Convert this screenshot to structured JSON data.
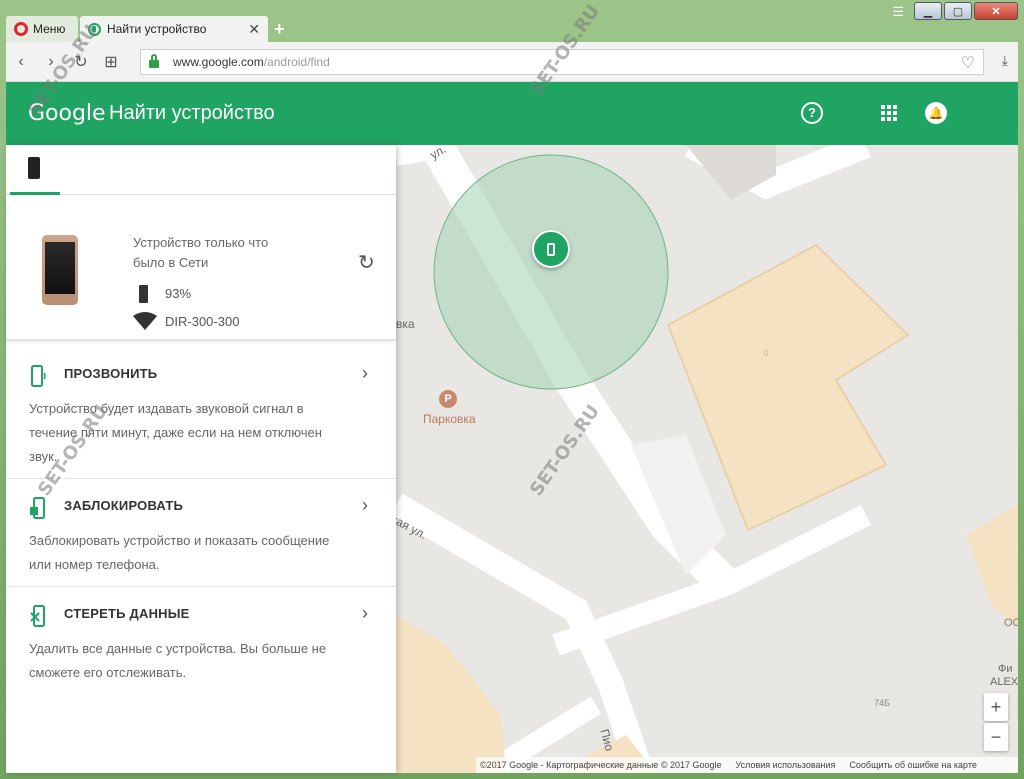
{
  "browser": {
    "menu_label": "Меню",
    "active_tab_title": "Найти устройство",
    "newtab_label": "+",
    "url_host": "www.google.com",
    "url_path": "/android/find"
  },
  "app": {
    "logo": "Google",
    "title": "Найти устройство"
  },
  "device": {
    "status_line": "Устройство только что было в Сети",
    "battery": "93%",
    "network": "DIR-300-300"
  },
  "actions": [
    {
      "title": "ПРОЗВОНИТЬ",
      "desc": "Устройство будет издавать звуковой сигнал в течение пяти минут, даже если на нем отключен звук."
    },
    {
      "title": "ЗАБЛОКИРОВАТЬ",
      "desc": "Заблокировать устройство и показать сообщение или номер телефона."
    },
    {
      "title": "СТЕРЕТЬ ДАННЫЕ",
      "desc": "Удалить все данные с устройства. Вы больше не сможете его отслеживать."
    }
  ],
  "map": {
    "parking_label": "Парковка",
    "parking_icon_letter": "P",
    "street_ul": "ул.",
    "street_kaya": "кая ул.",
    "label_vka": "вка",
    "label_pio": "Пио",
    "label_oc": "ОС",
    "label_fi": "Фи",
    "label_alex": "ALEX",
    "label_74b": "74Б",
    "label_0": "0",
    "zoom_in": "+",
    "zoom_out": "−",
    "footer_copyright": "©2017 Google - Картографические данные © 2017 Google",
    "footer_terms": "Условия использования",
    "footer_report": "Сообщить об ошибке на карте"
  },
  "watermark": "SET-OS.RU",
  "colors": {
    "brand_green": "#1fa463",
    "accuracy_circle": "#a8d5b8",
    "building": "#f4e2c3"
  }
}
